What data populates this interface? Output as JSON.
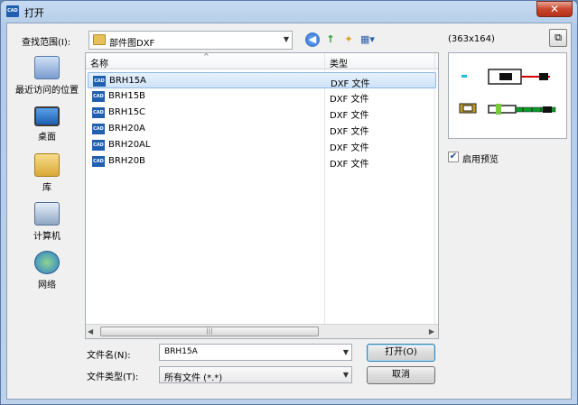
{
  "window": {
    "title": "打开",
    "app_icon": "CAD",
    "close_glyph": "✕"
  },
  "lookin": {
    "label": "查找范围(I):",
    "value": "部件图DXF"
  },
  "places": [
    {
      "label": "最近访问的位置",
      "icon": "recent-places-icon"
    },
    {
      "label": "桌面",
      "icon": "desktop-icon"
    },
    {
      "label": "库",
      "icon": "library-icon"
    },
    {
      "label": "计算机",
      "icon": "computer-icon"
    },
    {
      "label": "网络",
      "icon": "network-icon"
    }
  ],
  "filelist": {
    "columns": [
      "名称",
      "类型"
    ],
    "files": [
      {
        "name": "BRH15A",
        "type": "DXF 文件",
        "selected": true
      },
      {
        "name": "BRH15B",
        "type": "DXF 文件"
      },
      {
        "name": "BRH15C",
        "type": "DXF 文件"
      },
      {
        "name": "BRH20A",
        "type": "DXF 文件"
      },
      {
        "name": "BRH20AL",
        "type": "DXF 文件"
      },
      {
        "name": "BRH20B",
        "type": "DXF 文件"
      }
    ]
  },
  "preview": {
    "size": "(363x164)",
    "enable_label": "启用预览",
    "enabled": true
  },
  "bottom": {
    "filename_label": "文件名(N):",
    "filename_value": "BRH15A",
    "filetype_label": "文件类型(T):",
    "filetype_value": "所有文件 (*.*)",
    "open_label": "打开(O)",
    "cancel_label": "取消"
  }
}
